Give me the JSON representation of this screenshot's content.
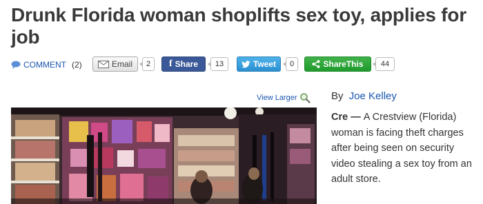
{
  "article": {
    "headline": "Drunk Florida woman shoplifts sex toy, applies for job",
    "byline_prefix": "By",
    "author": "Joe Kelley",
    "lead": "Cre — ",
    "body": "A Crestview (Florida) woman is facing theft charges after being seen on security video stealing a sex toy from an adult store."
  },
  "share_bar": {
    "comment_label": "COMMENT",
    "comment_count": "(2)",
    "email_label": "Email",
    "email_count": "2",
    "facebook_label": "Share",
    "facebook_count": "13",
    "tweet_label": "Tweet",
    "tweet_count": "0",
    "sharethis_label": "ShareThis",
    "sharethis_count": "44"
  },
  "photo": {
    "view_larger_label": "View Larger"
  },
  "colors": {
    "link": "#1a56b0",
    "facebook": "#3b5998",
    "twitter": "#2a8fd0",
    "sharethis": "#1f9a2d"
  },
  "icons": [
    "comment-bubble-icon",
    "envelope-icon",
    "facebook-icon",
    "twitter-bird-icon",
    "share-icon",
    "magnifier-icon"
  ]
}
